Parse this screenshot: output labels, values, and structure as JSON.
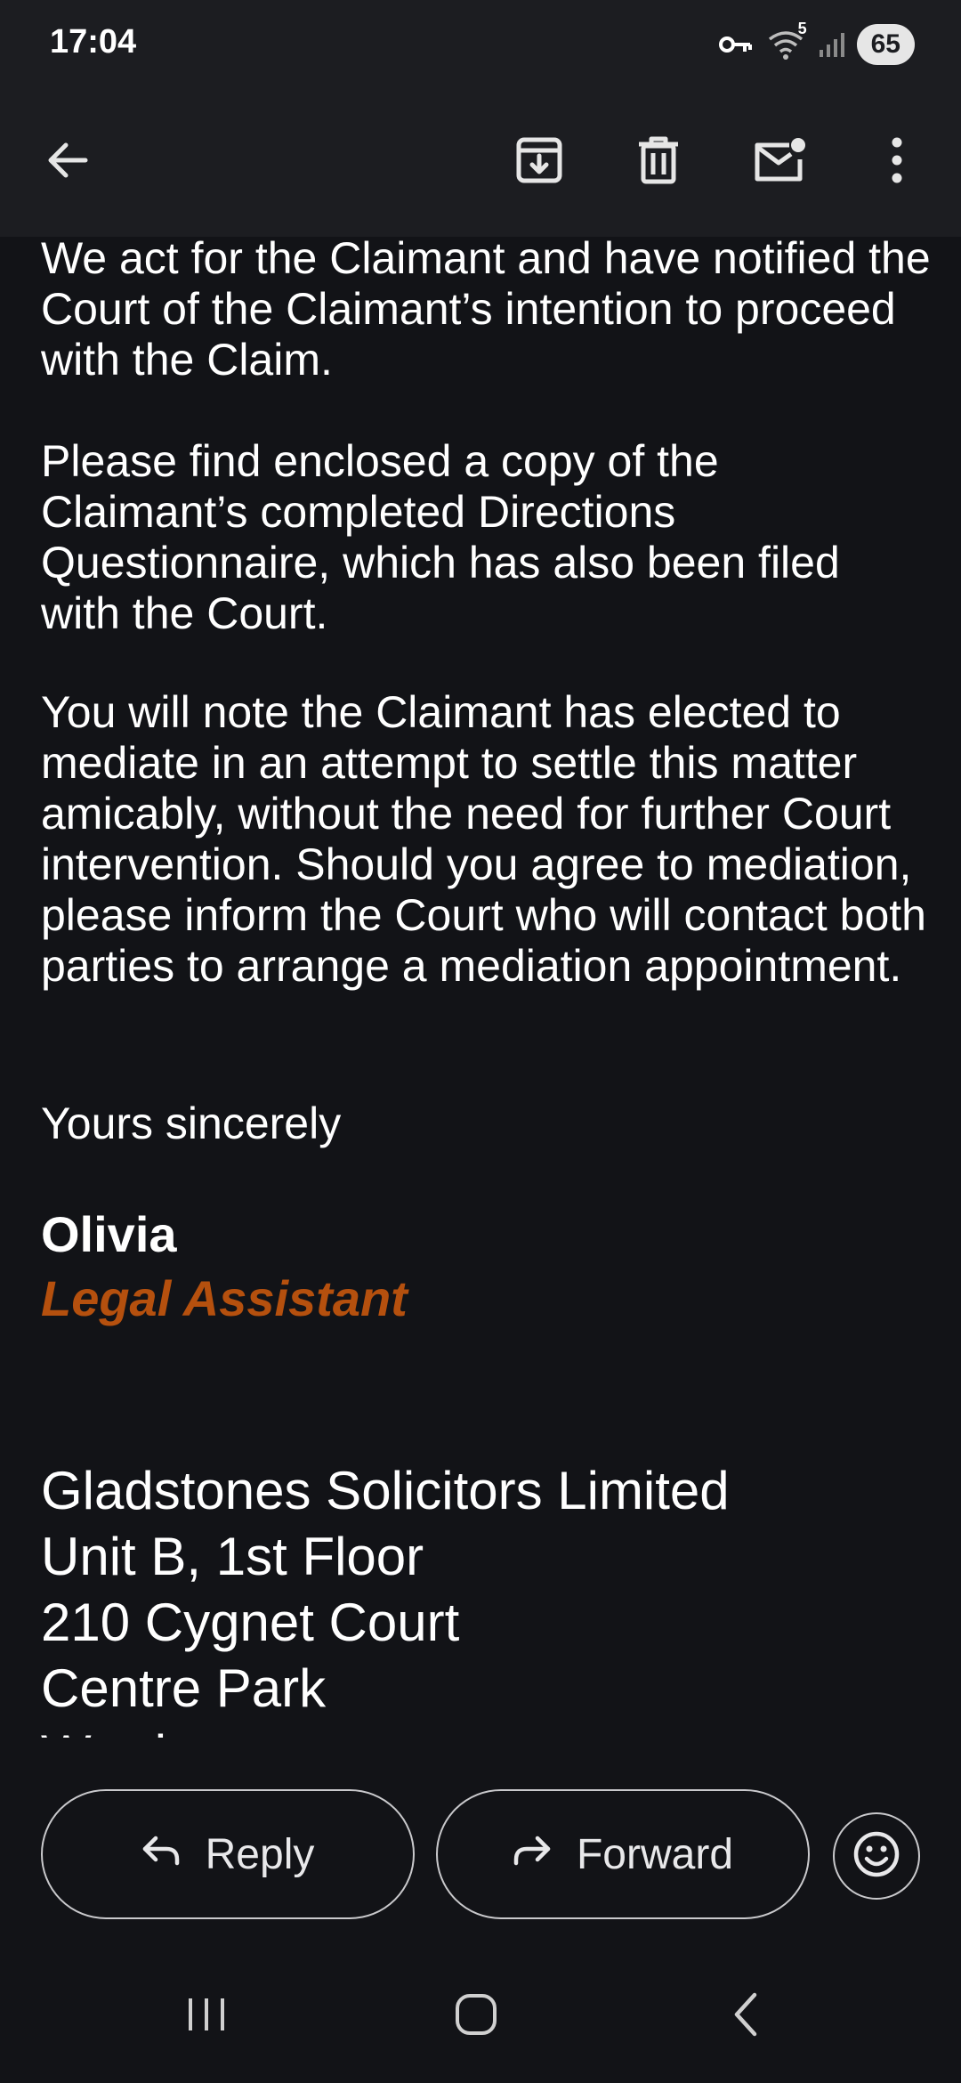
{
  "status_bar": {
    "time": "17:04",
    "wifi_label": "5",
    "battery": "65",
    "icons": [
      "vpn-key-icon",
      "wifi-icon",
      "signal-icon",
      "battery-icon"
    ]
  },
  "toolbar": {
    "icons": [
      "back-arrow-icon",
      "archive-icon",
      "delete-icon",
      "mark-unread-icon",
      "more-vert-icon"
    ]
  },
  "email": {
    "paragraph_1": "We act for the Claimant and have notified the Court of the Claimant’s intention to proceed with the Claim.",
    "paragraph_2": "Please find enclosed a copy of the Claimant’s completed Directions Questionnaire, which has also been filed with the Court.",
    "paragraph_3": "You will note the Claimant has elected to mediate in an attempt to settle this matter amicably, without the need for further Court intervention. Should you agree to mediation, please inform the Court who will contact both parties to arrange a mediation appointment.",
    "closing": "Yours sincerely",
    "signature_name": "Olivia",
    "signature_title": "Legal Assistant",
    "address_lines": [
      "Gladstones Solicitors Limited",
      "Unit B, 1st Floor",
      "210 Cygnet Court",
      "Centre Park",
      "Warrington"
    ]
  },
  "actions": {
    "reply_label": "Reply",
    "forward_label": "Forward"
  },
  "colors": {
    "background": "#121317",
    "bar": "#1c1d21",
    "signature_title": "#b5500e",
    "text": "#ffffff"
  }
}
